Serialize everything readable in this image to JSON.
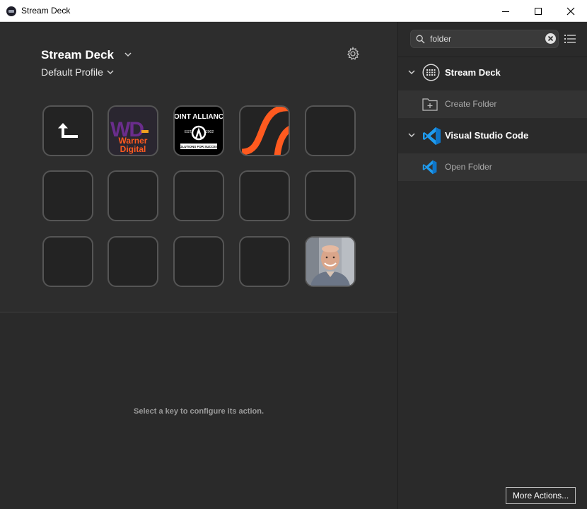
{
  "window": {
    "title": "Stream Deck",
    "app_icon": "stream-deck-app-icon",
    "controls": [
      "minimize-icon",
      "maximize-icon",
      "close-icon"
    ]
  },
  "device": {
    "name": "Stream Deck",
    "profile": "Default Profile"
  },
  "keys": [
    {
      "row": 1,
      "col": 1,
      "type": "back-folder",
      "icon": "return-arrow-icon"
    },
    {
      "row": 1,
      "col": 2,
      "type": "image",
      "icon": "warner-digital-logo",
      "text": [
        "Warner",
        "Digital"
      ]
    },
    {
      "row": 1,
      "col": 3,
      "type": "image",
      "icon": "point-alliance-logo",
      "text": [
        "POINT ALLIANCE",
        "EST.",
        "2002",
        "SOLUTIONS FOR SUCCESS"
      ]
    },
    {
      "row": 1,
      "col": 4,
      "type": "image",
      "icon": "orange-swoosh-logo"
    },
    {
      "row": 1,
      "col": 5,
      "type": "empty"
    },
    {
      "row": 2,
      "col": 1,
      "type": "empty"
    },
    {
      "row": 2,
      "col": 2,
      "type": "empty"
    },
    {
      "row": 2,
      "col": 3,
      "type": "empty"
    },
    {
      "row": 2,
      "col": 4,
      "type": "empty"
    },
    {
      "row": 2,
      "col": 5,
      "type": "empty"
    },
    {
      "row": 3,
      "col": 1,
      "type": "empty"
    },
    {
      "row": 3,
      "col": 2,
      "type": "empty"
    },
    {
      "row": 3,
      "col": 3,
      "type": "empty"
    },
    {
      "row": 3,
      "col": 4,
      "type": "empty"
    },
    {
      "row": 3,
      "col": 5,
      "type": "image",
      "icon": "profile-photo"
    }
  ],
  "config": {
    "message": "Select a key to configure its action."
  },
  "search": {
    "value": "folder",
    "placeholder": ""
  },
  "categories": [
    {
      "label": "Stream Deck",
      "icon": "stream-deck-icon",
      "actions": [
        {
          "label": "Create Folder",
          "icon": "create-folder-icon"
        }
      ]
    },
    {
      "label": "Visual Studio Code",
      "icon": "vscode-icon",
      "actions": [
        {
          "label": "Open Folder",
          "icon": "vscode-icon"
        }
      ]
    }
  ],
  "more_actions_label": "More Actions...",
  "colors": {
    "accent_orange": "#ff5a1f",
    "vscode_blue": "#1f9cf0",
    "warner_purple": "#6a2d8c"
  }
}
